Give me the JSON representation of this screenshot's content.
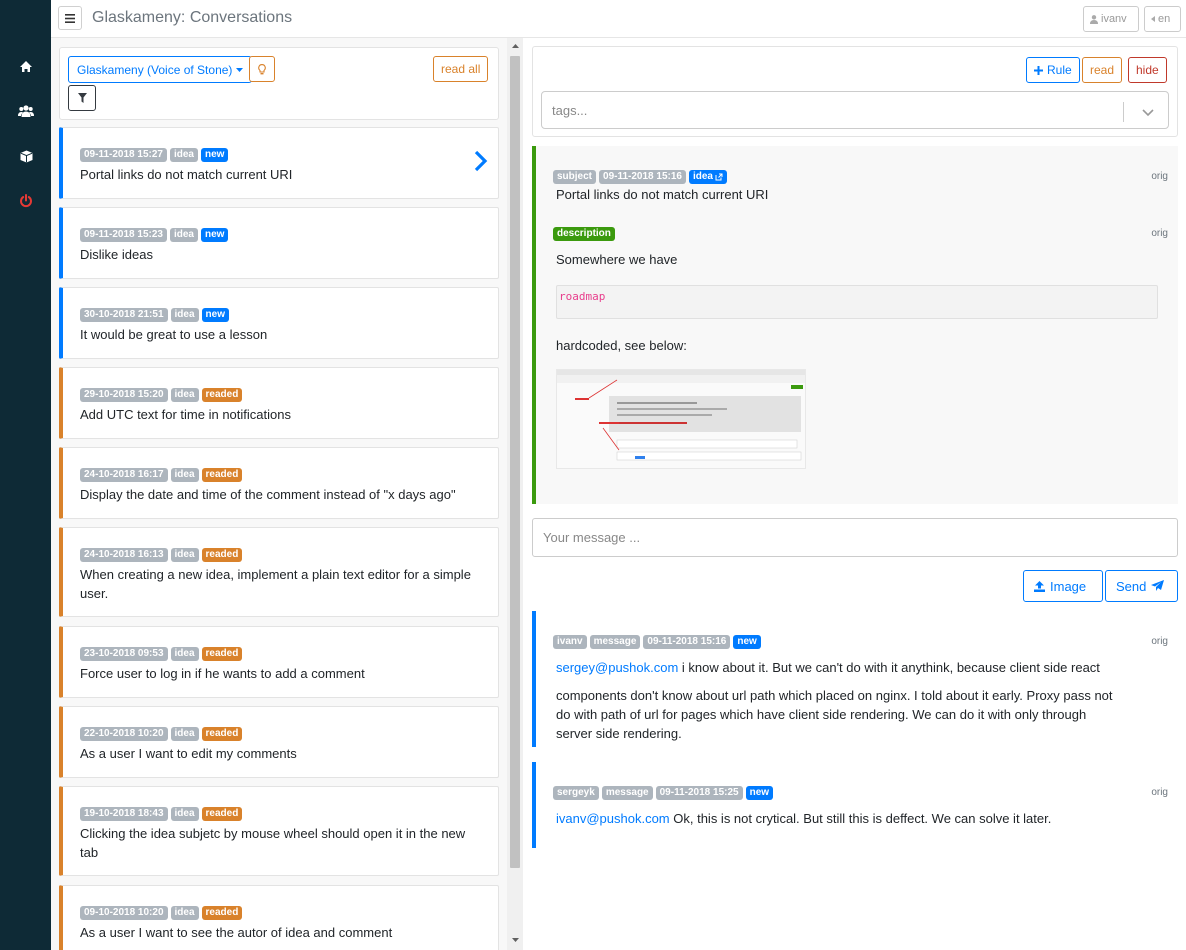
{
  "header": {
    "title": "Glaskameny: Conversations",
    "user_label": "ivanv",
    "lang_label": "en"
  },
  "sidebar": {
    "items": [
      {
        "icon": "home-icon"
      },
      {
        "icon": "users-icon"
      },
      {
        "icon": "cube-icon"
      },
      {
        "icon": "power-icon"
      }
    ]
  },
  "filters": {
    "project_label": "Glaskameny (Voice of Stone)",
    "read_all_label": "read all"
  },
  "conversations": [
    {
      "date": "09-11-2018 15:27",
      "type": "idea",
      "status": "new",
      "title": "Portal links do not match current URI"
    },
    {
      "date": "09-11-2018 15:23",
      "type": "idea",
      "status": "new",
      "title": "Dislike ideas"
    },
    {
      "date": "30-10-2018 21:51",
      "type": "idea",
      "status": "new",
      "title": "It would be great to use a lesson"
    },
    {
      "date": "29-10-2018 15:20",
      "type": "idea",
      "status": "readed",
      "title": "Add UTC text for time in notifications"
    },
    {
      "date": "24-10-2018 16:17",
      "type": "idea",
      "status": "readed",
      "title": "Display the date and time of the comment instead of \"x days ago\""
    },
    {
      "date": "24-10-2018 16:13",
      "type": "idea",
      "status": "readed",
      "title": "When creating a new idea, implement a plain text editor for a simple user."
    },
    {
      "date": "23-10-2018 09:53",
      "type": "idea",
      "status": "readed",
      "title": "Force user to log in if he wants to add a comment"
    },
    {
      "date": "22-10-2018 10:20",
      "type": "idea",
      "status": "readed",
      "title": "As a user I want to edit my comments"
    },
    {
      "date": "19-10-2018 18:43",
      "type": "idea",
      "status": "readed",
      "title": "Clicking the idea subjetc by mouse wheel should open it in the new tab"
    },
    {
      "date": "09-10-2018 10:20",
      "type": "idea",
      "status": "readed",
      "title": "As a user I want to see the autor of idea and comment"
    }
  ],
  "detail": {
    "rule_label": "Rule",
    "read_label": "read",
    "hide_label": "hide",
    "tags_placeholder": "tags...",
    "subject_badge": "subject",
    "subject_date": "09-11-2018 15:16",
    "subject_type": "idea",
    "subject_text": "Portal links do not match current URI",
    "orig_label": "orig",
    "description_badge": "description",
    "desc_line1": "Somewhere we have",
    "desc_code": "roadmap",
    "desc_line2": "hardcoded, see below:",
    "message_placeholder": "Your message ...",
    "image_label": "Image",
    "send_label": "Send"
  },
  "messages": [
    {
      "author": "ivanv",
      "kind": "message",
      "date": "09-11-2018 15:16",
      "status": "new",
      "mention": "sergey@pushok.com",
      "text_line1": " i know about it. But we can't do with it anythink, because client side react",
      "text_line2": "components don't know about url path which placed on nginx. I told about it early. Proxy pass not",
      "text_line3": "do with path of url for pages which have client side rendering. We can do it with only through",
      "text_line4": "server side rendering."
    },
    {
      "author": "sergeyk",
      "kind": "message",
      "date": "09-11-2018 15:25",
      "status": "new",
      "mention": "ivanv@pushok.com",
      "text_line1": " Ok, this is not crytical. But still this is deffect. We can solve it later."
    }
  ],
  "colors": {
    "sidebar": "#0e2a36",
    "primary": "#007bff",
    "warning": "#d9822b",
    "success": "#3b9a0e",
    "danger": "#c0392b"
  }
}
